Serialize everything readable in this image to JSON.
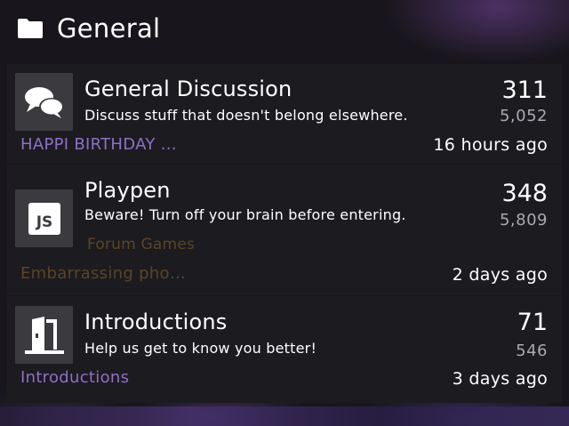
{
  "category": {
    "title": "General",
    "icon": "folder-icon"
  },
  "forums": [
    {
      "title": "General Discussion",
      "description": "Discuss stuff that doesn't belong elsewhere.",
      "icon": "chat-bubbles-icon",
      "topics": "311",
      "posts": "5,052",
      "last_post_title": "HAPPI BIRTHDAY …",
      "last_post_time": "16 hours ago"
    },
    {
      "title": "Playpen",
      "description": "Beware! Turn off your brain before entering.",
      "icon": "js-badge-icon",
      "icon_text": "JS",
      "topics": "348",
      "posts": "5,809",
      "subforum": "Forum Games",
      "last_post_title": "Embarrassing pho…",
      "last_post_time": "2 days ago"
    },
    {
      "title": "Introductions",
      "description": "Help us get to know you better!",
      "icon": "door-icon",
      "topics": "71",
      "posts": "546",
      "last_post_title": "Introductions",
      "last_post_time": "3 days ago"
    }
  ],
  "colors": {
    "link_purple": "#8f6fc9",
    "link_brown": "#5a4526",
    "secondary_gray": "#a9a9b0",
    "row_bg": "#1c1b1f"
  }
}
